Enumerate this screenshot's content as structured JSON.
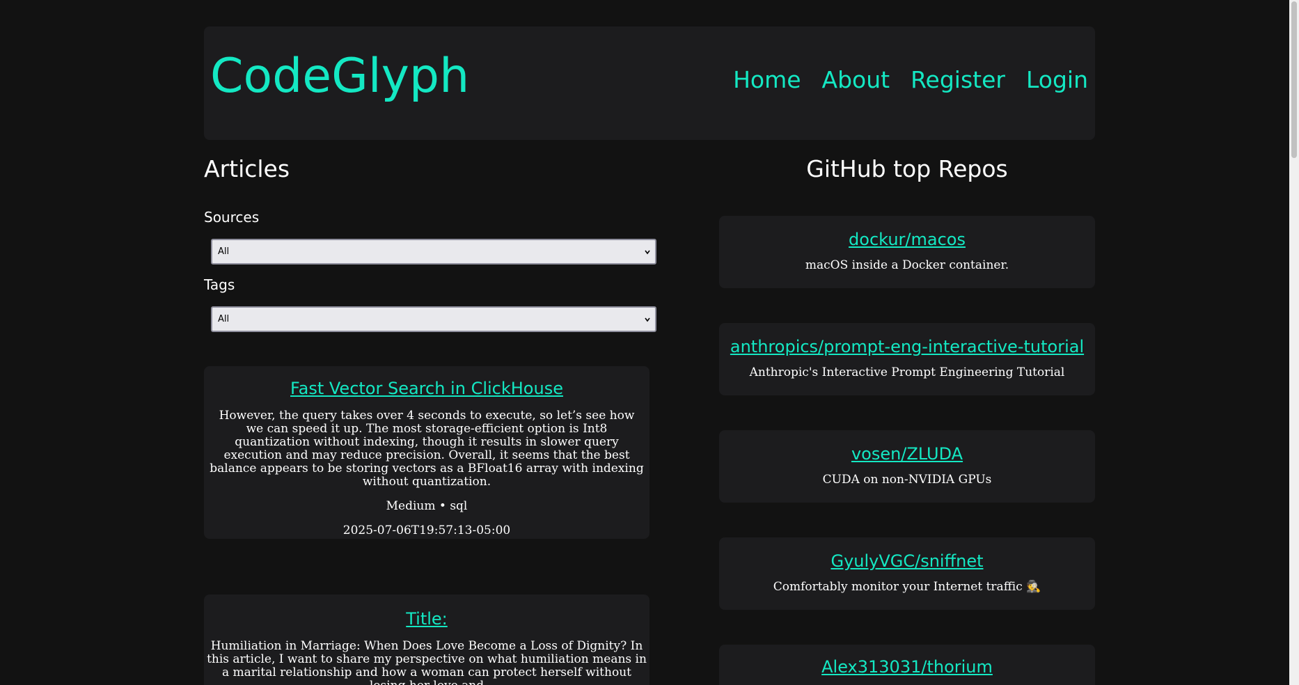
{
  "header": {
    "brand": "CodeGlyph",
    "nav": [
      "Home",
      "About",
      "Register",
      "Login"
    ]
  },
  "articles": {
    "heading": "Articles",
    "sources_label": "Sources",
    "sources_value": "All",
    "tags_label": "Tags",
    "tags_value": "All",
    "items": [
      {
        "title": "Fast Vector Search in ClickHouse",
        "summary": "However, the query takes over 4 seconds to execute, so let’s see how we can speed it up. The most storage-efficient option is Int8 quantization without indexing, though it results in slower query execution and may reduce precision. Overall, it seems that the best balance appears to be storing vectors as a BFloat16 array with indexing without quantization.",
        "meta": "Medium • sql",
        "date": "2025-07-06T19:57:13-05:00"
      },
      {
        "title": "Title:",
        "summary": "Humiliation in Marriage: When Does Love Become a Loss of Dignity? In this article, I want to share my perspective on what humiliation means in a marital relationship and how a woman can protect herself without losing her love and"
      }
    ]
  },
  "repos": {
    "heading": "GitHub top Repos",
    "items": [
      {
        "name": "dockur/macos",
        "description": "macOS inside a Docker container."
      },
      {
        "name": "anthropics/prompt-eng-interactive-tutorial",
        "description": "Anthropic's Interactive Prompt Engineering Tutorial"
      },
      {
        "name": "vosen/ZLUDA",
        "description": "CUDA on non-NVIDIA GPUs"
      },
      {
        "name": "GyulyVGC/sniffnet",
        "description": "Comfortably monitor your Internet traffic 🕵️"
      },
      {
        "name": "Alex313031/thorium",
        "description": ""
      }
    ]
  },
  "colors": {
    "background": "#121212",
    "card": "#1c1c1e",
    "accent": "#14e8c3",
    "text": "#ffffff"
  }
}
